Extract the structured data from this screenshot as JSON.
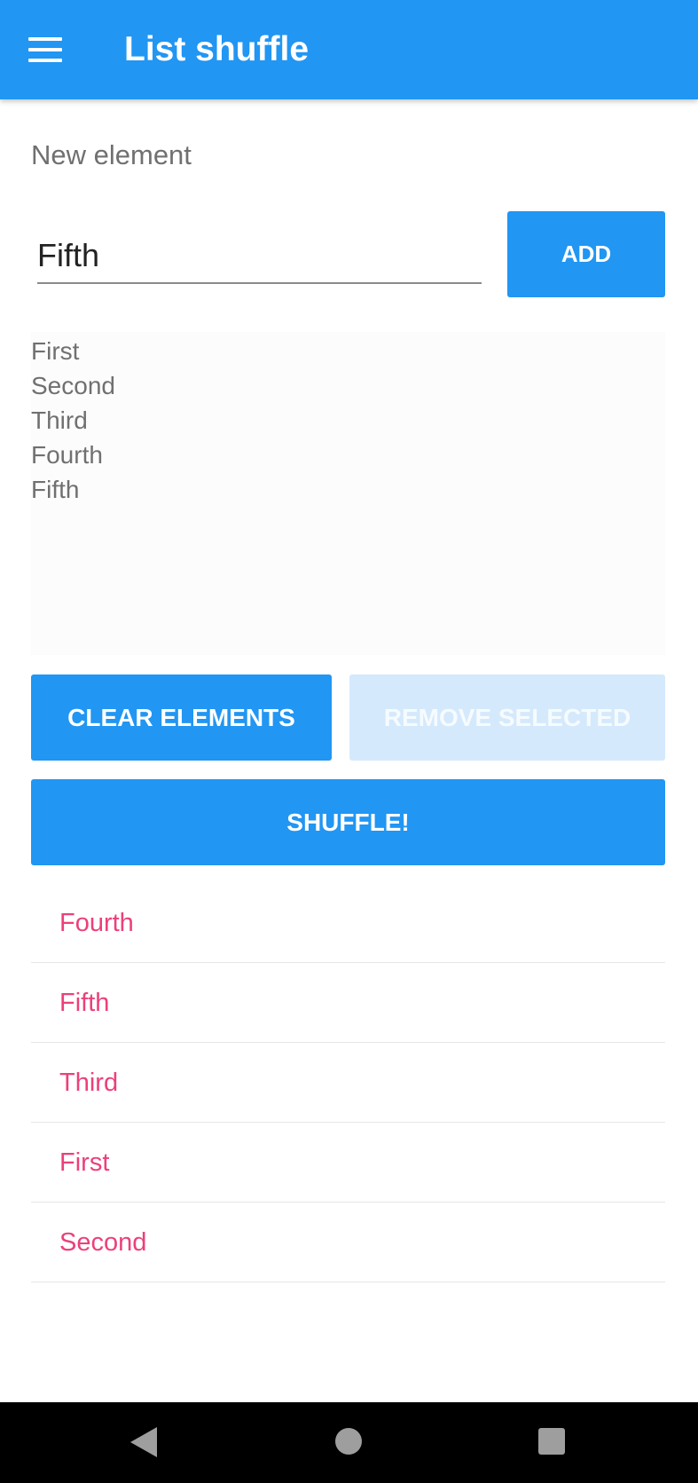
{
  "app_bar": {
    "title": "List shuffle",
    "menu_icon": "menu-icon",
    "color": "#2196F3"
  },
  "form": {
    "label": "New element",
    "input_value": "Fifth",
    "add_label": "ADD"
  },
  "elements": [
    "First",
    "Second",
    "Third",
    "Fourth",
    "Fifth"
  ],
  "actions": {
    "clear_label": "CLEAR ELEMENTS",
    "remove_label": "REMOVE SELECTED",
    "shuffle_label": "SHUFFLE!"
  },
  "shuffled": [
    "Fourth",
    "Fifth",
    "Third",
    "First",
    "Second"
  ],
  "result_color": "#EC407A",
  "nav_bar": {
    "back_icon": "back-icon",
    "home_icon": "home-icon",
    "recents_icon": "recents-icon"
  }
}
